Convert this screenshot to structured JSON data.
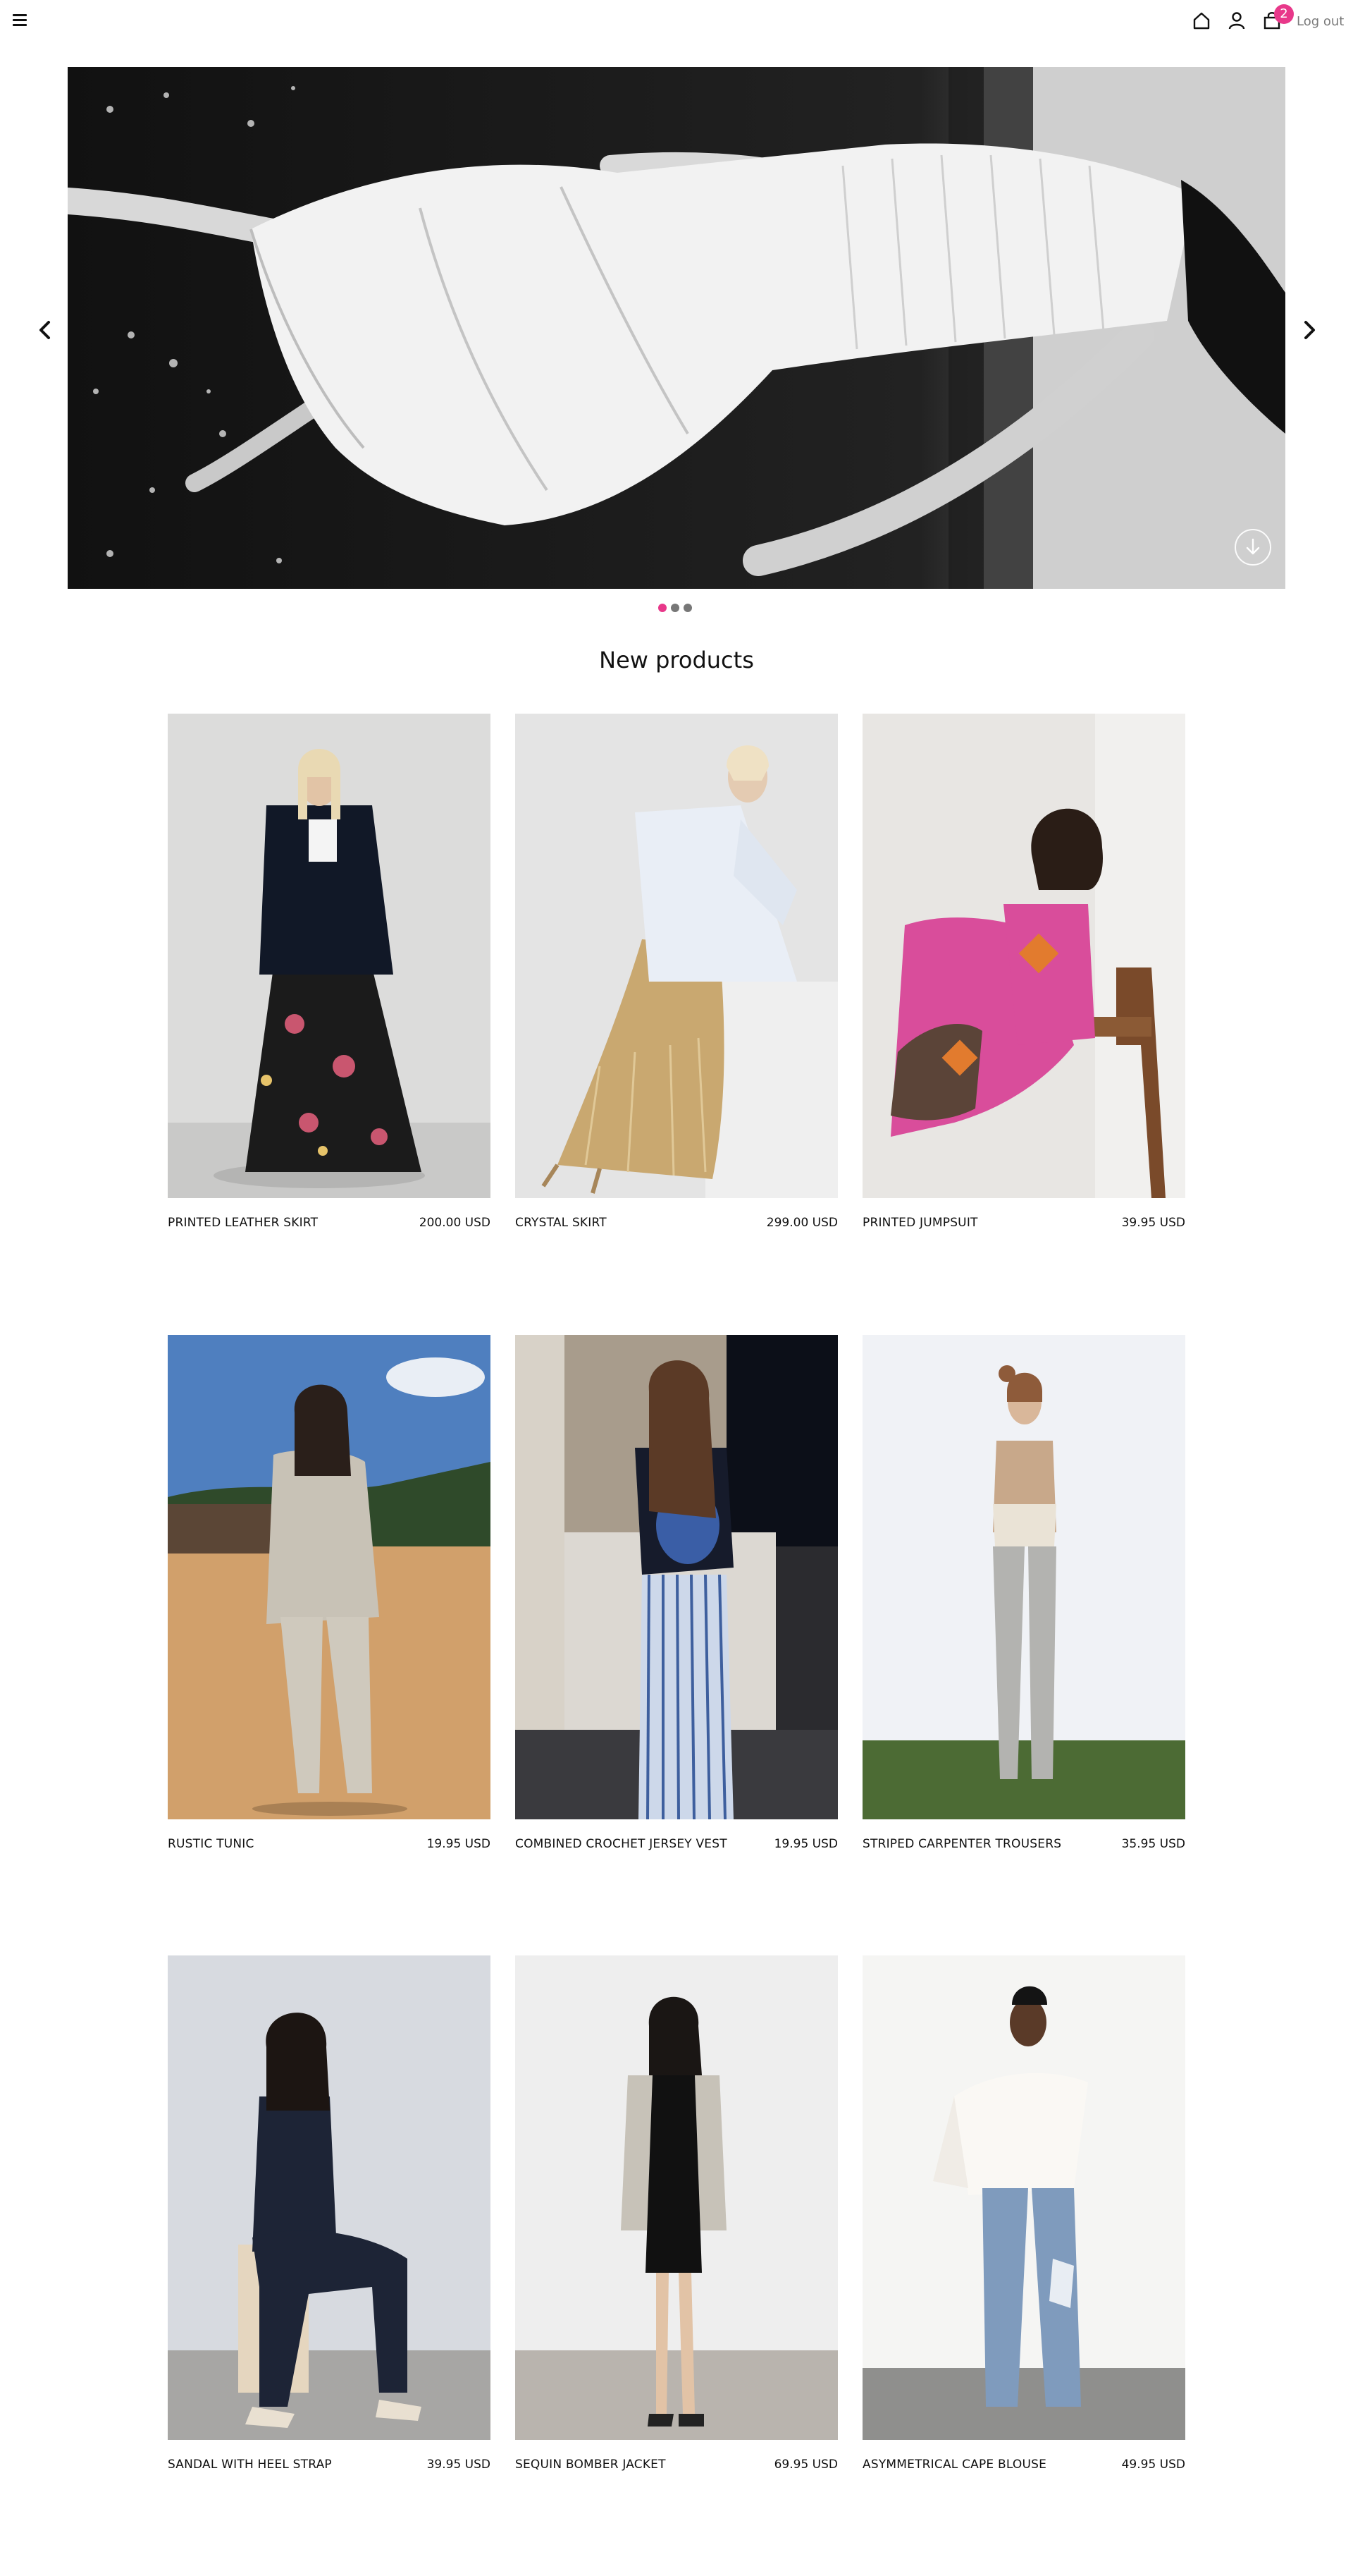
{
  "header": {
    "menu_icon": "hamburger-menu-icon",
    "home_icon": "home-icon",
    "account_icon": "user-icon",
    "cart_icon": "shopping-bag-icon",
    "cart_count": "2",
    "logout_label": "Log out",
    "badge_color": "#e8388a"
  },
  "hero": {
    "prev_icon": "chevron-left-icon",
    "next_icon": "chevron-right-icon",
    "scroll_icon": "arrow-down-circle-icon",
    "slide_count": 3,
    "active_slide": 1,
    "active_dot_color": "#e8388a",
    "inactive_dot_color": "#777777"
  },
  "section": {
    "title": "New products"
  },
  "products": [
    {
      "name": "PRINTED LEATHER SKIRT",
      "price": "200.00 USD"
    },
    {
      "name": "CRYSTAL SKIRT",
      "price": "299.00 USD"
    },
    {
      "name": "PRINTED JUMPSUIT",
      "price": "39.95 USD"
    },
    {
      "name": "RUSTIC TUNIC",
      "price": "19.95 USD"
    },
    {
      "name": "COMBINED CROCHET JERSEY VEST",
      "price": "19.95 USD"
    },
    {
      "name": "STRIPED CARPENTER TROUSERS",
      "price": "35.95 USD"
    },
    {
      "name": "SANDAL WITH HEEL STRAP",
      "price": "39.95 USD"
    },
    {
      "name": "SEQUIN BOMBER JACKET",
      "price": "69.95 USD"
    },
    {
      "name": "ASYMMETRICAL CAPE BLOUSE",
      "price": "49.95 USD"
    }
  ]
}
